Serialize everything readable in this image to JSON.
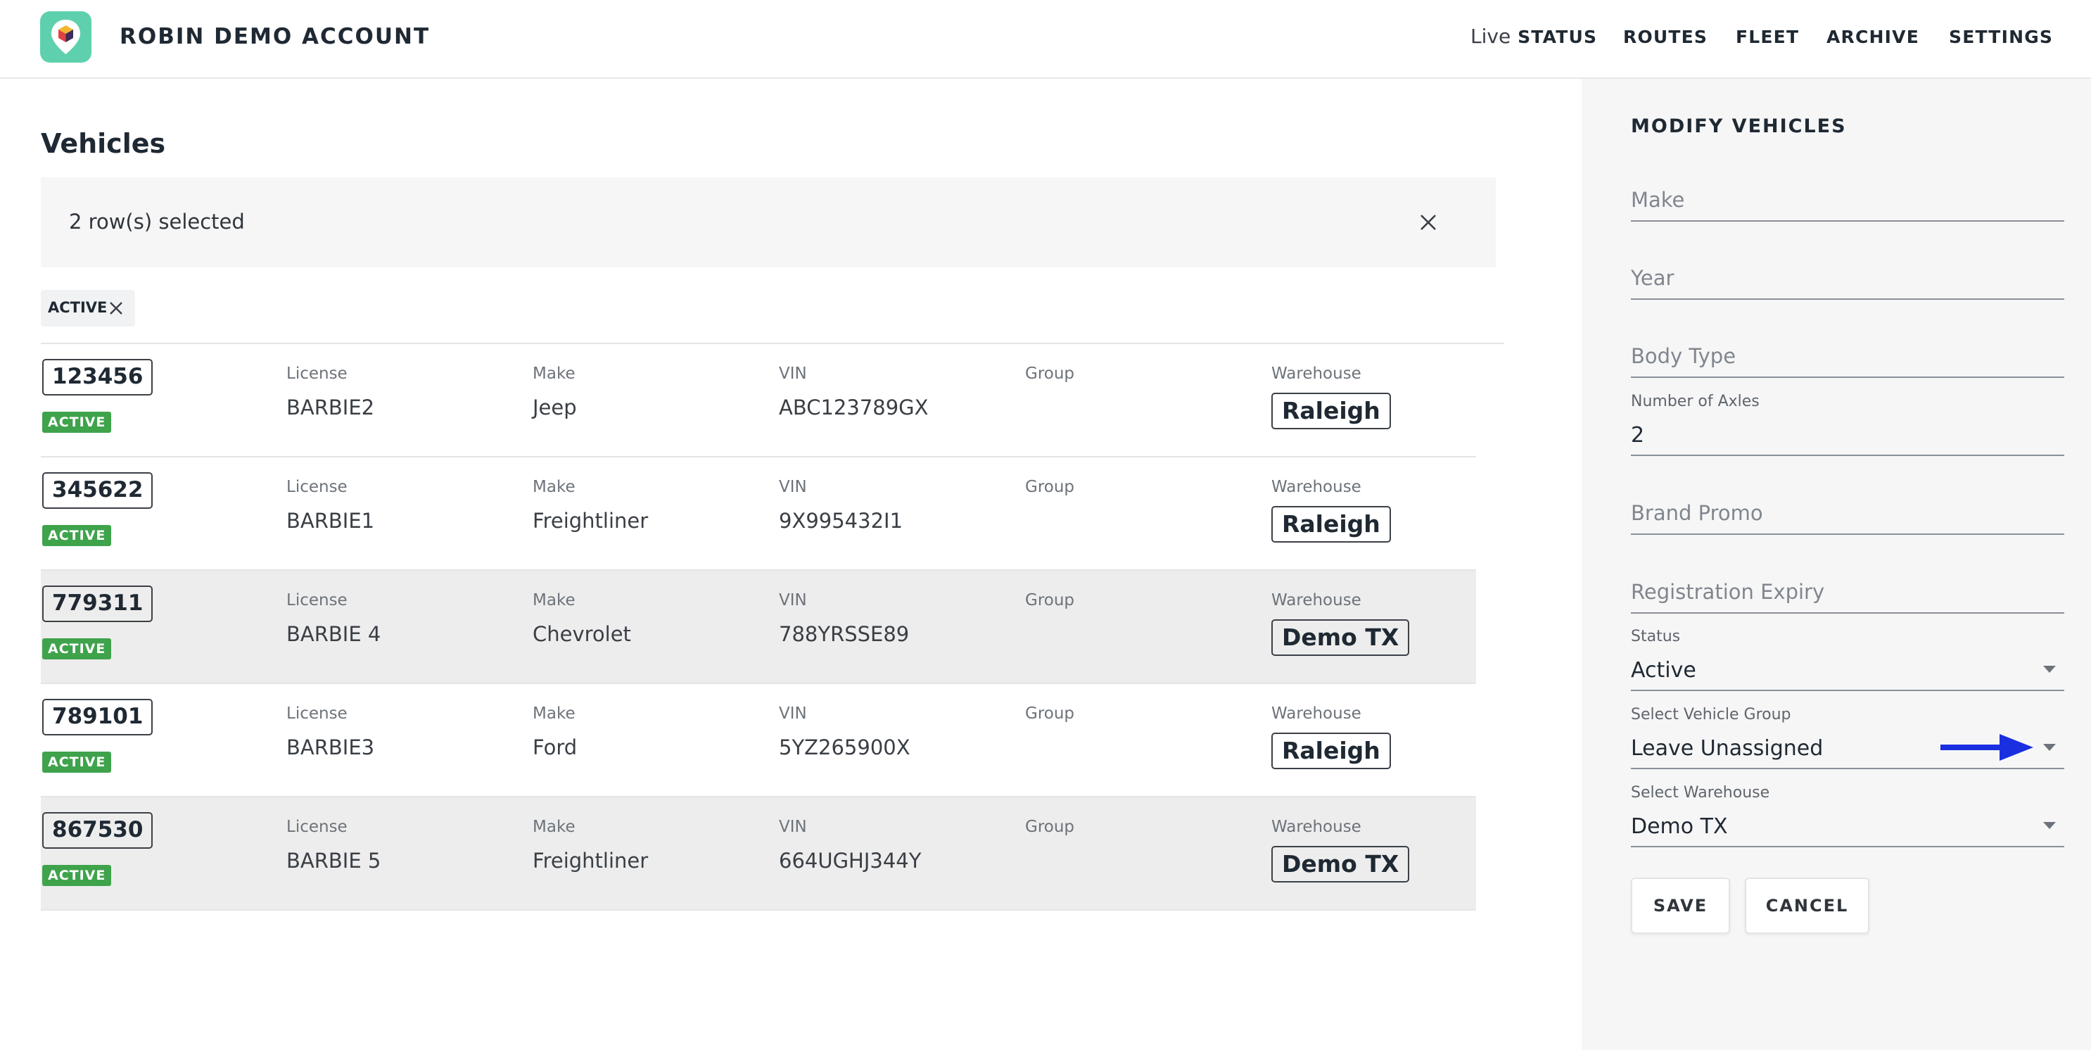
{
  "header": {
    "account_name": "ROBIN DEMO ACCOUNT",
    "nav": {
      "live_prefix": "Live",
      "live_status": "STATUS",
      "routes": "ROUTES",
      "fleet": "FLEET",
      "archive": "ARCHIVE",
      "settings": "SETTINGS"
    }
  },
  "main": {
    "title": "Vehicles",
    "selection_text": "2 row(s) selected",
    "filter_chip": "ACTIVE",
    "column_labels": {
      "license": "License",
      "make": "Make",
      "vin": "VIN",
      "group": "Group",
      "warehouse": "Warehouse"
    },
    "rows": [
      {
        "id": "123456",
        "status": "ACTIVE",
        "license": "BARBIE2",
        "make": "Jeep",
        "vin": "ABC123789GX",
        "group": "",
        "warehouse": "Raleigh",
        "shaded": false
      },
      {
        "id": "345622",
        "status": "ACTIVE",
        "license": "BARBIE1",
        "make": "Freightliner",
        "vin": "9X995432I1",
        "group": "",
        "warehouse": "Raleigh",
        "shaded": false
      },
      {
        "id": "779311",
        "status": "ACTIVE",
        "license": "BARBIE 4",
        "make": "Chevrolet",
        "vin": "788YRSSE89",
        "group": "",
        "warehouse": "Demo TX",
        "shaded": true
      },
      {
        "id": "789101",
        "status": "ACTIVE",
        "license": "BARBIE3",
        "make": "Ford",
        "vin": "5YZ265900X",
        "group": "",
        "warehouse": "Raleigh",
        "shaded": false
      },
      {
        "id": "867530",
        "status": "ACTIVE",
        "license": "BARBIE 5",
        "make": "Freightliner",
        "vin": "664UGHJ344Y",
        "group": "",
        "warehouse": "Demo TX",
        "shaded": true
      }
    ]
  },
  "panel": {
    "title": "MODIFY VEHICLES",
    "make_placeholder": "Make",
    "year_placeholder": "Year",
    "body_type_placeholder": "Body Type",
    "axles_label": "Number of Axles",
    "axles_value": "2",
    "brand_promo_placeholder": "Brand Promo",
    "registration_placeholder": "Registration Expiry",
    "status_label": "Status",
    "status_value": "Active",
    "group_label": "Select Vehicle Group",
    "group_value": "Leave Unassigned",
    "warehouse_label": "Select Warehouse",
    "warehouse_value": "Demo TX",
    "save_label": "SAVE",
    "cancel_label": "CANCEL"
  },
  "colors": {
    "logo_bg": "#5fd0ad",
    "active_badge": "#3ea34b",
    "annotation_arrow": "#1a2fe0",
    "panel_bg": "#f6f6f7"
  },
  "icons": {
    "logo": "cube-pin-logo",
    "clear_selection": "close-icon",
    "remove_filter": "close-icon",
    "dropdown": "caret-down-icon",
    "annotation": "arrow-right-icon"
  }
}
